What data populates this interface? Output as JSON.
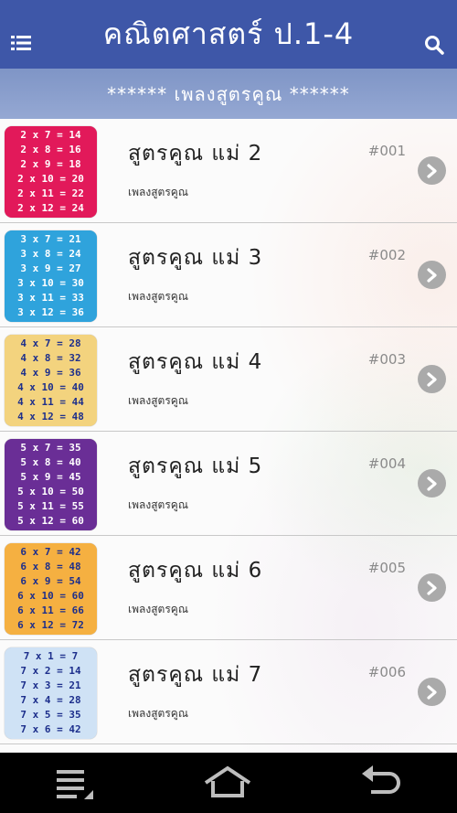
{
  "header": {
    "title": "คณิตศาสตร์ ป.1-4",
    "menu_icon": "menu-list-icon",
    "search_icon": "search-icon",
    "background": "#3e57a8"
  },
  "banner": {
    "text": "****** เพลงสูตรคูณ ******"
  },
  "items": [
    {
      "title": "สูตรคูณ  แม่ 2",
      "subtitle": "เพลงสูตรคูณ",
      "number": "#001",
      "thumb_lines": [
        "2 x 7 = 14",
        "2 x 8 = 16",
        "2 x 9 = 18",
        "2 x 10 = 20",
        "2 x 11 = 22",
        "2 x 12 = 24"
      ],
      "thumb_color": "#e2195a",
      "thumb_light": false
    },
    {
      "title": "สูตรคูณ  แม่ 3",
      "subtitle": "เพลงสูตรคูณ",
      "number": "#002",
      "thumb_lines": [
        "3 x 7 = 21",
        "3 x 8 = 24",
        "3 x 9 = 27",
        "3 x 10 = 30",
        "3 x 11 = 33",
        "3 x 12 = 36"
      ],
      "thumb_color": "#2fa3dc",
      "thumb_light": false
    },
    {
      "title": "สูตรคูณ  แม่ 4",
      "subtitle": "เพลงสูตรคูณ",
      "number": "#003",
      "thumb_lines": [
        "4 x 7 = 28",
        "4 x 8 = 32",
        "4 x 9 = 36",
        "4 x 10 = 40",
        "4 x 11 = 44",
        "4 x 12 = 48"
      ],
      "thumb_color": "#f3d37e",
      "thumb_light": true
    },
    {
      "title": "สูตรคูณ  แม่ 5",
      "subtitle": "เพลงสูตรคูณ",
      "number": "#004",
      "thumb_lines": [
        "5 x 7 = 35",
        "5 x 8 = 40",
        "5 x 9 = 45",
        "5 x 10 = 50",
        "5 x 11 = 55",
        "5 x 12 = 60"
      ],
      "thumb_color": "#6a2e96",
      "thumb_light": false
    },
    {
      "title": "สูตรคูณ  แม่ 6",
      "subtitle": "เพลงสูตรคูณ",
      "number": "#005",
      "thumb_lines": [
        "6 x 7 = 42",
        "6 x 8 = 48",
        "6 x 9 = 54",
        "6 x 10 = 60",
        "6 x 11 = 66",
        "6 x 12 = 72"
      ],
      "thumb_color": "#f5b041",
      "thumb_light": true
    },
    {
      "title": "สูตรคูณ  แม่ 7",
      "subtitle": "เพลงสูตรคูณ",
      "number": "#006",
      "thumb_lines": [
        "7 x 1 = 7",
        "7 x 2 = 14",
        "7 x 3 = 21",
        "7 x 4 = 28",
        "7 x 5 = 35",
        "7 x 6 = 42"
      ],
      "thumb_color": "#cfe2f5",
      "thumb_light": true
    }
  ],
  "nav": {
    "recent_icon": "recent-apps-icon",
    "home_icon": "home-icon",
    "back_icon": "back-icon"
  }
}
